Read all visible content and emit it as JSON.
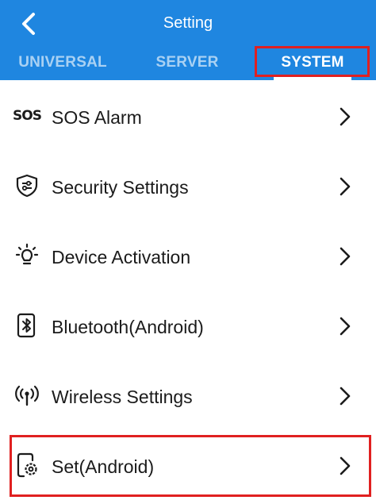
{
  "header": {
    "title": "Setting",
    "background": "#1f86e0"
  },
  "tabs": [
    {
      "label": "UNIVERSAL",
      "active": false
    },
    {
      "label": "SERVER",
      "active": false
    },
    {
      "label": "SYSTEM",
      "active": true
    }
  ],
  "items": [
    {
      "label": "SOS Alarm",
      "icon": "sos-icon",
      "icon_text": "SOS"
    },
    {
      "label": "Security Settings",
      "icon": "shield-settings-icon"
    },
    {
      "label": "Device Activation",
      "icon": "lightbulb-icon"
    },
    {
      "label": "Bluetooth(Android)",
      "icon": "bluetooth-phone-icon"
    },
    {
      "label": "Wireless Settings",
      "icon": "wireless-antenna-icon"
    },
    {
      "label": "Set(Android)",
      "icon": "phone-settings-icon"
    }
  ],
  "highlight_color": "#e02020"
}
